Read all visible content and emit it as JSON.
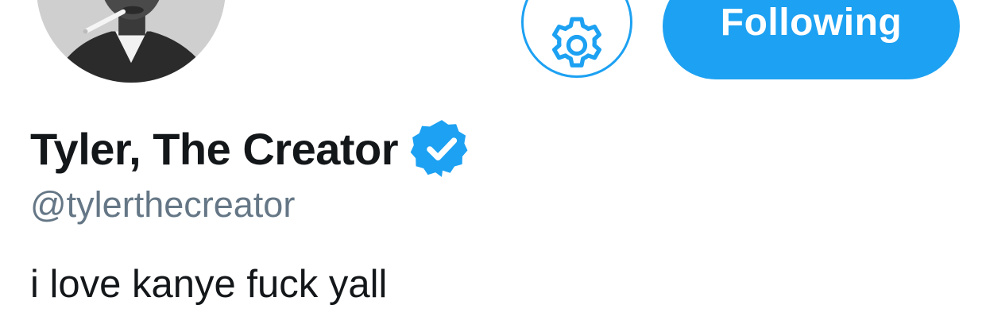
{
  "profile": {
    "display_name": "Tyler, The Creator",
    "handle": "@tylerthecreator",
    "bio": "i love kanye fuck yall",
    "verified": true,
    "avatar": "profile-photo"
  },
  "actions": {
    "settings_icon": "gear-icon",
    "follow_label": "Following"
  },
  "colors": {
    "accent": "#1da1f2",
    "name": "#14171a",
    "handle": "#657786",
    "background": "#ffffff"
  }
}
